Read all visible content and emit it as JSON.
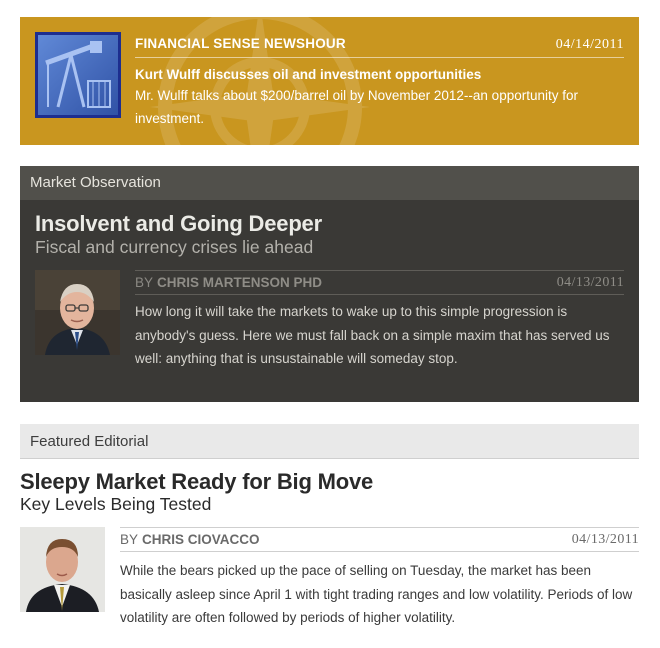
{
  "newshour": {
    "label": "FINANCIAL SENSE NEWSHOUR",
    "date": "04/14/2011",
    "title": "Kurt Wulff discusses oil and investment opportunities",
    "description": "Mr. Wulff talks about $200/barrel oil by November 2012--an opportunity for investment.",
    "thumbnail_icon": "oil-pump-icon"
  },
  "market_observation": {
    "section_label": "Market Observation",
    "title": "Insolvent and Going Deeper",
    "subtitle": "Fiscal and currency crises lie ahead",
    "by_word": "BY",
    "author": "CHRIS MARTENSON PHD",
    "date": "04/13/2011",
    "text": "How long it will take the markets to wake up to this simple progression is anybody's guess. Here we must fall back on a simple maxim that has served us well: anything that is unsustainable will someday stop."
  },
  "featured_editorial": {
    "section_label": "Featured Editorial",
    "title": "Sleepy Market Ready for Big Move",
    "subtitle": "Key Levels Being Tested",
    "by_word": "BY",
    "author": "CHRIS CIOVACCO",
    "date": "04/13/2011",
    "text": "While the bears picked up the pace of selling on Tuesday, the market has been basically asleep since April 1 with tight trading ranges and low volatility. Periods of low volatility are often followed by periods of higher volatility."
  },
  "colors": {
    "newshour_bg": "#c9961f",
    "market_bg": "#3a3936",
    "market_bar": "#51504b",
    "featured_bar": "#e9e9e9"
  }
}
